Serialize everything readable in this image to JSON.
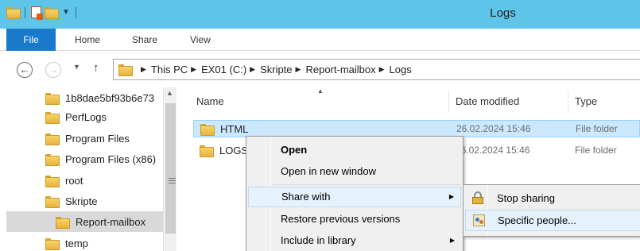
{
  "window": {
    "title": "Logs"
  },
  "quick_access": {
    "icons": [
      "folder-icon",
      "properties-icon",
      "new-folder-icon",
      "customize-dropdown-icon"
    ]
  },
  "ribbon": {
    "tabs": [
      "File",
      "Home",
      "Share",
      "View"
    ]
  },
  "address": {
    "nav_icons": [
      "back-arrow-icon",
      "forward-arrow-icon",
      "recent-locations-icon",
      "up-arrow-icon"
    ],
    "breadcrumbs": [
      "This PC",
      "EX01 (C:)",
      "Skripte",
      "Report-mailbox",
      "Logs"
    ]
  },
  "nav_pane": {
    "items": [
      {
        "label": "1b8dae5bf93b6e73",
        "selected": false
      },
      {
        "label": "PerfLogs",
        "selected": false
      },
      {
        "label": "Program Files",
        "selected": false
      },
      {
        "label": "Program Files (x86)",
        "selected": false
      },
      {
        "label": "root",
        "selected": false
      },
      {
        "label": "Skripte",
        "selected": false
      },
      {
        "label": "Report-mailbox",
        "selected": true
      },
      {
        "label": "temp",
        "selected": false
      }
    ]
  },
  "file_list": {
    "columns": {
      "name": "Name",
      "date": "Date modified",
      "type": "Type"
    },
    "rows": [
      {
        "name": "HTML",
        "date": "26.02.2024 15:46",
        "type": "File folder",
        "selected": true
      },
      {
        "name": "LOGS",
        "date": "26.02.2024 15:46",
        "type": "File folder",
        "selected": false
      }
    ]
  },
  "context_menu": {
    "items": [
      {
        "label": "Open",
        "bold": true
      },
      {
        "label": "Open in new window"
      },
      {
        "label": "Share with",
        "submenu": true,
        "highlighted": true
      },
      {
        "label": "Restore previous versions"
      },
      {
        "label": "Include in library",
        "submenu": true
      }
    ]
  },
  "share_submenu": {
    "items": [
      {
        "label": "Stop sharing",
        "icon": "lock-icon"
      },
      {
        "label": "Specific people...",
        "icon": "people-icon",
        "highlighted": true
      }
    ]
  },
  "colors": {
    "titlebar": "#5ec4e8",
    "file_tab": "#1979ca",
    "selection": "#cce8ff",
    "menu_hover": "#e5f1fb"
  }
}
